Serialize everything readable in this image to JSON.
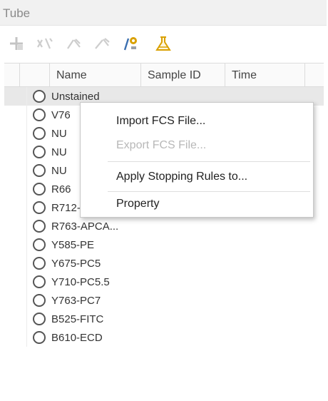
{
  "panel": {
    "title": "Tube"
  },
  "toolbar": {
    "buttons": [
      {
        "icon": "add-tube-icon"
      },
      {
        "icon": "split-icon"
      },
      {
        "icon": "delete-tube-icon"
      },
      {
        "icon": "delete-all-icon"
      },
      {
        "icon": "tube-settings-icon"
      },
      {
        "icon": "flask-icon"
      }
    ]
  },
  "grid": {
    "columns": [
      {
        "label": "Name"
      },
      {
        "label": "Sample ID"
      },
      {
        "label": "Time"
      }
    ],
    "rows": [
      {
        "name": "Unstained"
      },
      {
        "name": "V76"
      },
      {
        "name": "NU"
      },
      {
        "name": "NU"
      },
      {
        "name": "NU"
      },
      {
        "name": "R66"
      },
      {
        "name": "R712-APCA..."
      },
      {
        "name": "R763-APCA..."
      },
      {
        "name": "Y585-PE"
      },
      {
        "name": "Y675-PC5"
      },
      {
        "name": "Y710-PC5.5"
      },
      {
        "name": "Y763-PC7"
      },
      {
        "name": "B525-FITC"
      },
      {
        "name": "B610-ECD"
      }
    ]
  },
  "context_menu": {
    "items": [
      {
        "label": "Import FCS File...",
        "enabled": true
      },
      {
        "label": "Export FCS File...",
        "enabled": false
      },
      {
        "label": "Apply Stopping Rules to...",
        "enabled": true
      },
      {
        "label": "Property",
        "enabled": true
      }
    ]
  },
  "colors": {
    "title_bar": "#f1f1f1",
    "selected_row": "#e8e8e8",
    "disabled_text": "#b8b8b8",
    "icon_accent": "#d9a000"
  }
}
